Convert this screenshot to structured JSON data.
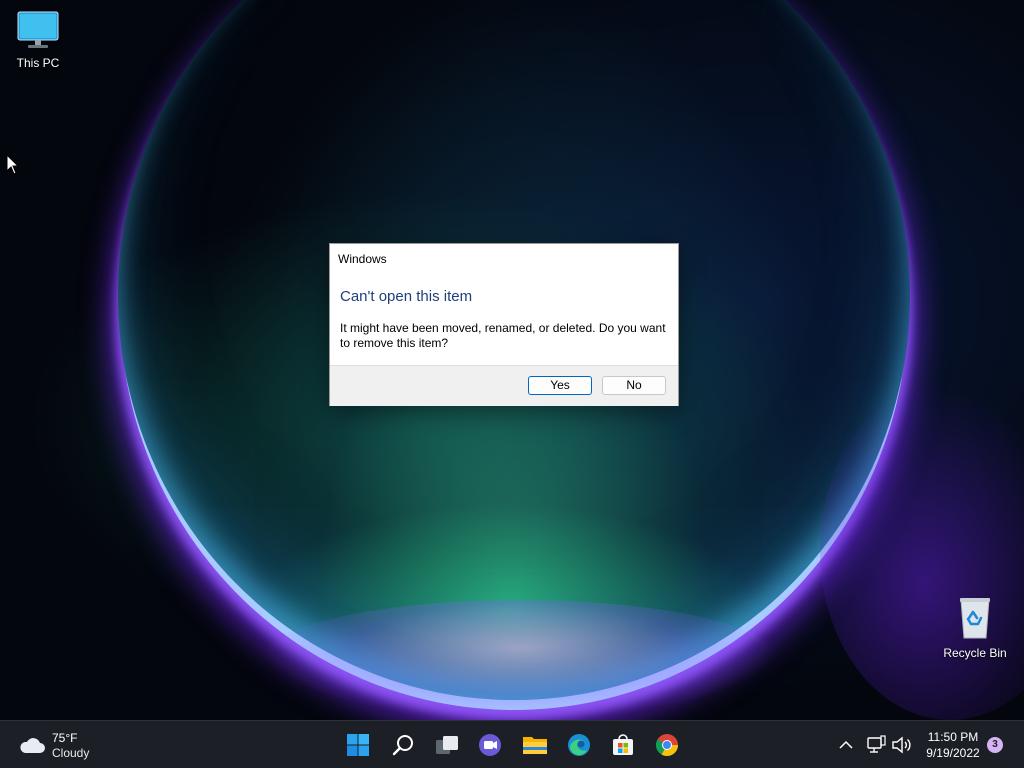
{
  "desktop": {
    "icons": [
      {
        "label": "This PC",
        "icon": "monitor-icon"
      },
      {
        "label": "Recycle Bin",
        "icon": "recycle-bin-icon"
      }
    ]
  },
  "dialog": {
    "window_title": "Windows",
    "heading": "Can't open this item",
    "message": "It might have been moved, renamed, or deleted. Do you want to remove this item?",
    "yes_label": "Yes",
    "no_label": "No",
    "heading_color": "#1f3f7a",
    "default_button_border": "#0067c0"
  },
  "taskbar": {
    "weather": {
      "temperature": "75°F",
      "condition": "Cloudy",
      "icon": "cloud-icon"
    },
    "pinned": [
      {
        "name": "start",
        "icon": "windows-logo-icon"
      },
      {
        "name": "search",
        "icon": "search-icon"
      },
      {
        "name": "task-view",
        "icon": "task-view-icon"
      },
      {
        "name": "chat",
        "icon": "teams-chat-icon"
      },
      {
        "name": "file-explorer",
        "icon": "folder-icon"
      },
      {
        "name": "edge",
        "icon": "edge-icon"
      },
      {
        "name": "store",
        "icon": "store-icon"
      },
      {
        "name": "chrome",
        "icon": "chrome-icon"
      }
    ],
    "tray": {
      "icons": [
        "chevron-up-icon",
        "network-icon",
        "volume-icon"
      ],
      "time": "11:50 PM",
      "date": "9/19/2022",
      "notification_count": "3"
    }
  }
}
